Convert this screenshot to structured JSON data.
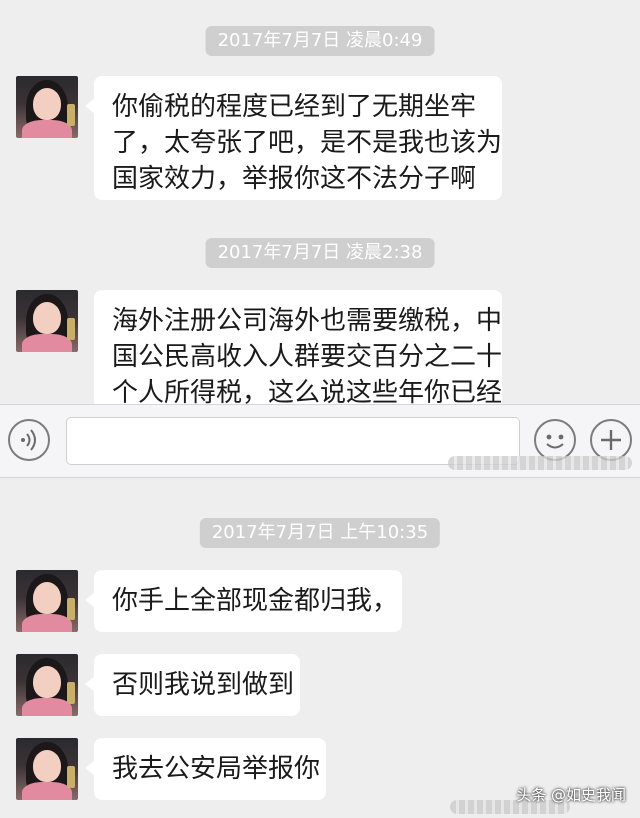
{
  "chat": {
    "timestamps": [
      "2017年7月7日 凌晨0:49",
      "2017年7月7日 凌晨2:38",
      "2017年7月7日 上午10:35"
    ],
    "messages": [
      {
        "lines": [
          "你偷税的程度已经到了无期坐牢",
          "了，太夸张了吧，是不是我也该为",
          "国家效力，举报你这不法分子啊"
        ]
      },
      {
        "lines": [
          "海外注册公司海外也需要缴税，中",
          "国公民高收入人群要交百分之二十",
          "个人所得税，这么说这些年你已经"
        ]
      },
      {
        "lines": [
          "你手上全部现金都归我，"
        ]
      },
      {
        "lines": [
          "否则我说到做到"
        ]
      },
      {
        "lines": [
          "我去公安局举报你"
        ]
      }
    ]
  },
  "input_bar": {
    "voice_icon": "voice-icon",
    "emoji_icon": "emoji-icon",
    "add_icon": "plus-icon"
  },
  "watermark": {
    "text": "头条 @如史我闻"
  }
}
